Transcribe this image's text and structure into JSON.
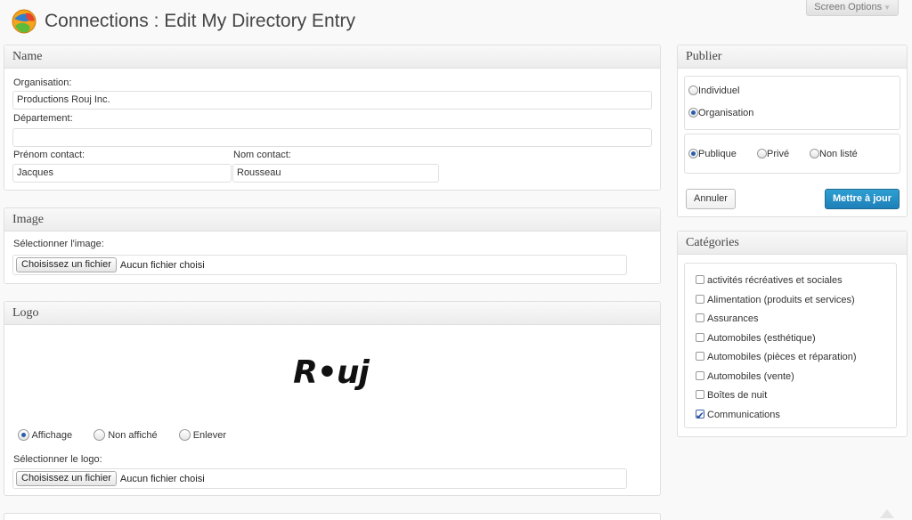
{
  "header": {
    "title": "Connections : Edit My Directory Entry",
    "screen_options_label": "Screen Options"
  },
  "name_box": {
    "title": "Name",
    "organisation_label": "Organisation:",
    "organisation_value": "Productions Rouj Inc.",
    "departement_label": "Département:",
    "departement_value": "",
    "prenom_label": "Prénom contact:",
    "prenom_value": "Jacques",
    "nom_label": "Nom contact:",
    "nom_value": "Rousseau"
  },
  "image_box": {
    "title": "Image",
    "select_label": "Sélectionner l'image:",
    "file_button": "Choisissez un fichier",
    "file_status": "Aucun fichier choisi"
  },
  "logo_box": {
    "title": "Logo",
    "logo_text": "R•uj",
    "options": [
      "Affichage",
      "Non affiché",
      "Enlever"
    ],
    "selected_option": "Affichage",
    "select_label": "Sélectionner le logo:",
    "file_button": "Choisissez un fichier",
    "file_status": "Aucun fichier choisi"
  },
  "publish_box": {
    "title": "Publier",
    "type_options": [
      "Individuel",
      "Organisation"
    ],
    "type_selected": "Organisation",
    "visibility_options": [
      "Publique",
      "Privé",
      "Non listé"
    ],
    "visibility_selected": "Publique",
    "cancel_label": "Annuler",
    "update_label": "Mettre à jour"
  },
  "categories_box": {
    "title": "Catégories",
    "items": [
      {
        "label": "activités récréatives et sociales",
        "checked": false
      },
      {
        "label": "Alimentation (produits et services)",
        "checked": false
      },
      {
        "label": "Assurances",
        "checked": false
      },
      {
        "label": "Automobiles (esthétique)",
        "checked": false
      },
      {
        "label": "Automobiles (pièces et réparation)",
        "checked": false
      },
      {
        "label": "Automobiles (vente)",
        "checked": false
      },
      {
        "label": "Boîtes de nuit",
        "checked": false
      },
      {
        "label": "Communications",
        "checked": true
      }
    ]
  },
  "colors": {
    "primary_button": "#2a8fc7",
    "radio_selected": "#2a5db0"
  }
}
